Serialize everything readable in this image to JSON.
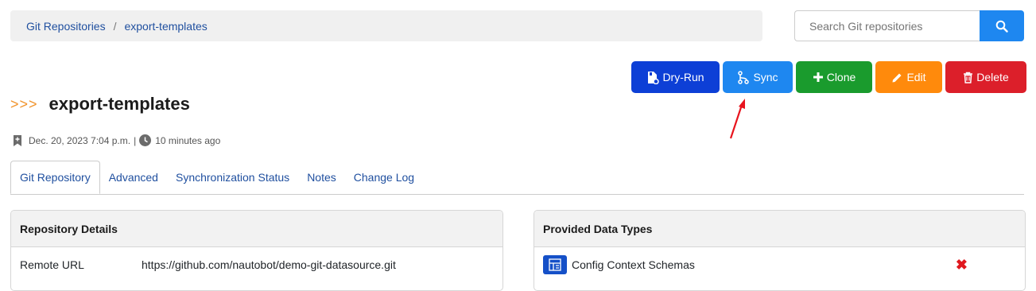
{
  "breadcrumb": {
    "root": "Git Repositories",
    "separator": "/",
    "current": "export-templates"
  },
  "search": {
    "placeholder": "Search Git repositories"
  },
  "actions": {
    "dryrun": "Dry-Run",
    "sync": "Sync",
    "clone": "Clone",
    "edit": "Edit",
    "delete": "Delete"
  },
  "header": {
    "chevrons": ">>>",
    "title": "export-templates"
  },
  "meta": {
    "created": "Dec. 20, 2023 7:04 p.m.",
    "separator": "|",
    "updated": "10 minutes ago"
  },
  "tabs": [
    {
      "label": "Git Repository"
    },
    {
      "label": "Advanced"
    },
    {
      "label": "Synchronization Status"
    },
    {
      "label": "Notes"
    },
    {
      "label": "Change Log"
    }
  ],
  "repo_details": {
    "title": "Repository Details",
    "rows": [
      {
        "label": "Remote URL",
        "value": "https://github.com/nautobot/demo-git-datasource.git"
      }
    ]
  },
  "data_types": {
    "title": "Provided Data Types",
    "items": [
      {
        "label": "Config Context Schemas",
        "status": "✖"
      }
    ]
  },
  "colors": {
    "link": "#1f4f9f",
    "dryrun": "#0d3fd6",
    "sync": "#1e87f0",
    "clone": "#1a9b2d",
    "edit": "#ff8a0c",
    "delete": "#dc1f2a",
    "annotation_arrow": "#e8141e"
  }
}
